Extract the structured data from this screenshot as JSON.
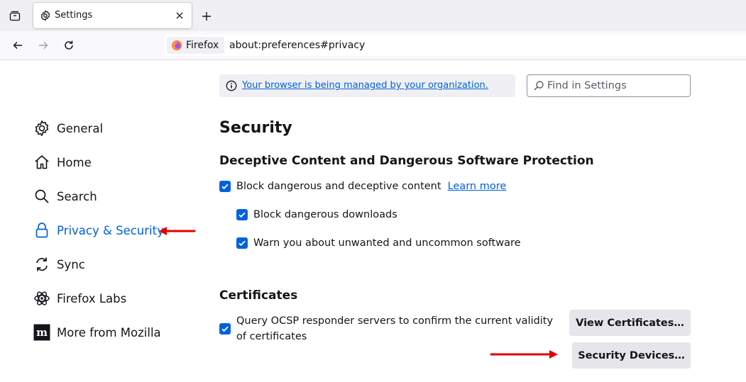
{
  "tab": {
    "title": "Settings"
  },
  "urlbar": {
    "identity_label": "Firefox",
    "url": "about:preferences#privacy"
  },
  "sidebar": {
    "items": [
      {
        "label": "General",
        "icon": "gear-icon"
      },
      {
        "label": "Home",
        "icon": "home-icon"
      },
      {
        "label": "Search",
        "icon": "search-icon"
      },
      {
        "label": "Privacy & Security",
        "icon": "lock-icon",
        "selected": true
      },
      {
        "label": "Sync",
        "icon": "sync-icon"
      },
      {
        "label": "Firefox Labs",
        "icon": "atom-icon"
      },
      {
        "label": "More from Mozilla",
        "icon": "mozilla-icon"
      }
    ]
  },
  "notice": {
    "text": "Your browser is being managed by your organization."
  },
  "search": {
    "placeholder": "Find in Settings"
  },
  "security": {
    "heading": "Security",
    "deceptive_heading": "Deceptive Content and Dangerous Software Protection",
    "block_deceptive": {
      "label": "Block dangerous and deceptive content",
      "checked": true
    },
    "learn_more": "Learn more",
    "block_downloads": {
      "label": "Block dangerous downloads",
      "checked": true
    },
    "warn_unwanted": {
      "label": "Warn you about unwanted and uncommon software",
      "checked": true
    }
  },
  "certificates": {
    "heading": "Certificates",
    "ocsp": {
      "label": "Query OCSP responder servers to confirm the current validity of certificates",
      "checked": true
    },
    "view_button": "View Certificates…",
    "devices_button": "Security Devices…"
  },
  "colors": {
    "accent": "#0061e0",
    "annotation_arrow": "#e00000"
  }
}
